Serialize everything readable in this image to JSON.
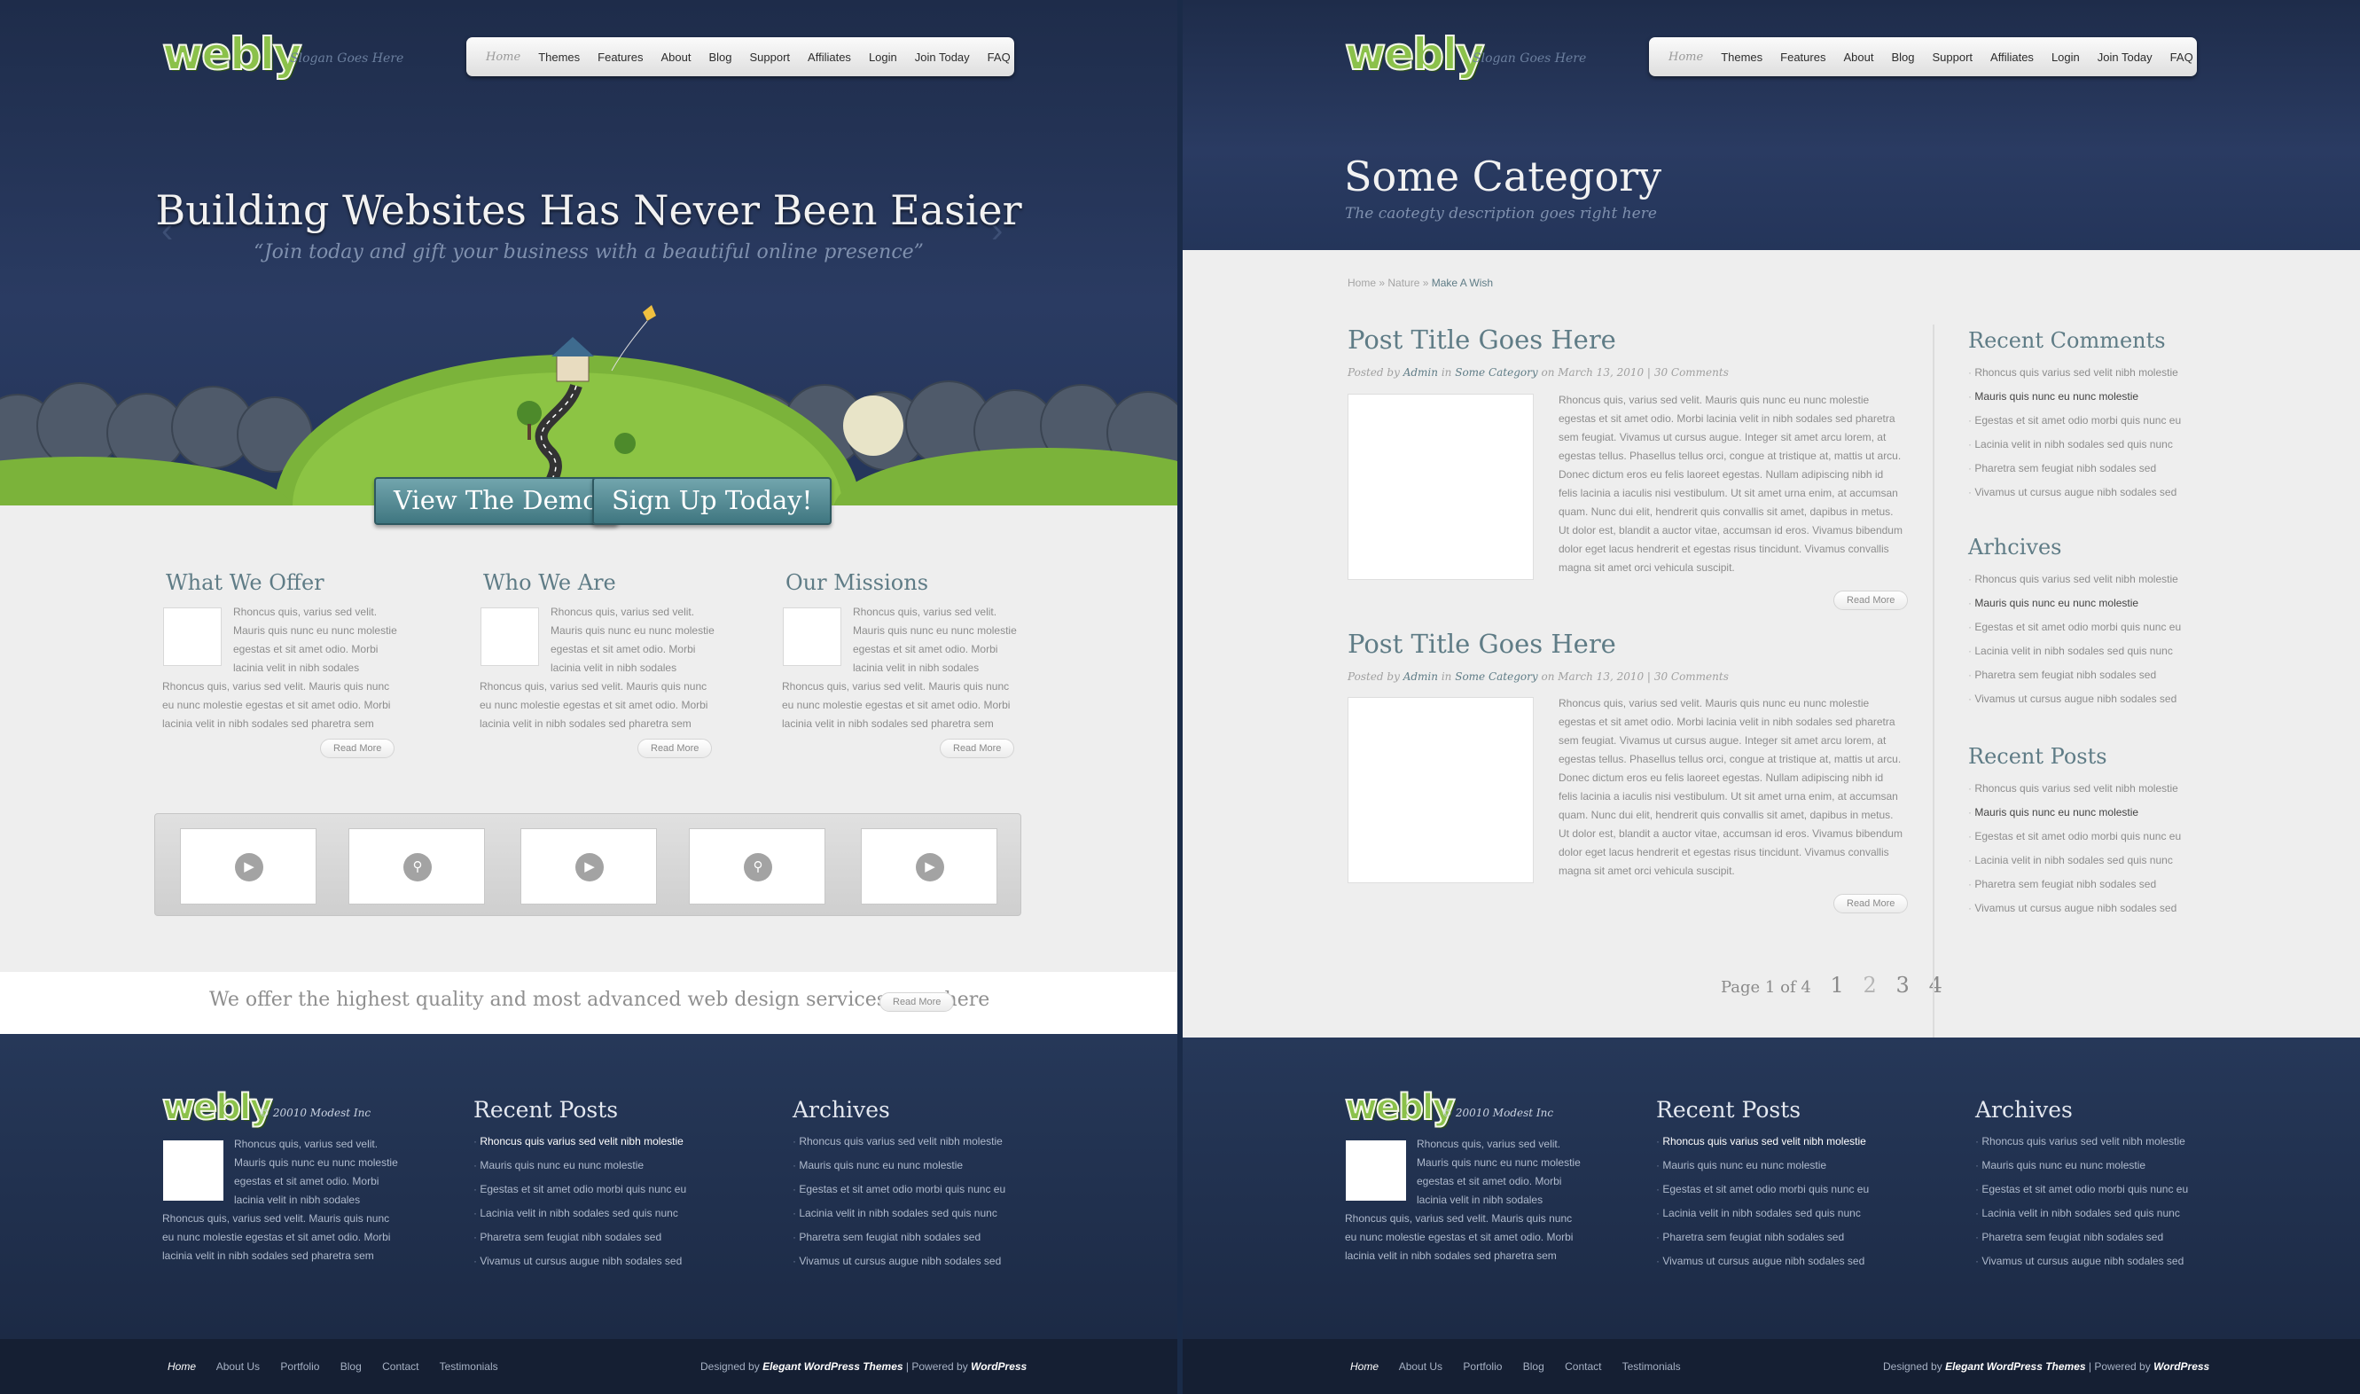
{
  "left": {
    "header": {
      "logo": "webly",
      "slogan": "Slogan Goes Here"
    },
    "nav": [
      "Home",
      "Themes",
      "Features",
      "About",
      "Blog",
      "Support",
      "Affiliates",
      "Login",
      "Join Today",
      "FAQ"
    ],
    "hero": {
      "title": "Building Websites Has Never Been Easier",
      "subtitle": "“Join today and gift your business with a beautiful online presence”",
      "demo_button": "View The Demo",
      "signup_button": "Sign Up Today!"
    },
    "columns": [
      {
        "title": "What We Offer",
        "text_a": "Rhoncus quis, varius sed velit. Mauris quis nunc eu nunc molestie egestas et sit amet odio. Morbi lacinia velit in nibh sodales",
        "text_b": "Rhoncus quis, varius sed velit. Mauris quis nunc eu nunc molestie egestas et sit amet odio. Morbi lacinia velit in nibh sodales sed pharetra sem"
      },
      {
        "title": "Who We Are",
        "text_a": "Rhoncus quis, varius sed velit. Mauris quis nunc eu nunc molestie egestas et sit amet odio. Morbi lacinia velit in nibh sodales",
        "text_b": "Rhoncus quis, varius sed velit. Mauris quis nunc eu nunc molestie egestas et sit amet odio. Morbi lacinia velit in nibh sodales sed pharetra sem"
      },
      {
        "title": "Our Missions",
        "text_a": "Rhoncus quis, varius sed velit. Mauris quis nunc eu nunc molestie egestas et sit amet odio. Morbi lacinia velit in nibh sodales",
        "text_b": "Rhoncus quis, varius sed velit. Mauris quis nunc eu nunc molestie egestas et sit amet odio. Morbi lacinia velit in nibh sodales sed pharetra sem"
      }
    ],
    "read_more": "Read More",
    "gallery_icons": [
      "play",
      "zoom",
      "play",
      "zoom",
      "play"
    ],
    "tagline": "We offer the highest quality and most advanced web design services anywhere"
  },
  "right": {
    "header": {
      "logo": "webly",
      "slogan": "Slogan Goes Here"
    },
    "category_title": "Some Category",
    "category_desc": "The caotegty description goes right here",
    "breadcrumb": {
      "home": "Home",
      "sep": " » ",
      "nature": "Nature",
      "current": "Make A Wish"
    },
    "posts": [
      {
        "title": "Post Title Goes Here",
        "posted_by": "Posted by",
        "author": "Admin",
        "in": "in",
        "category": "Some Category",
        "date": "on March 13, 2010 |",
        "comments": "30 Comments",
        "body": "Rhoncus quis, varius sed velit. Mauris quis nunc eu nunc molestie egestas et sit amet odio. Morbi lacinia velit in nibh sodales sed pharetra sem feugiat. Vivamus ut cursus augue. Integer sit amet arcu lorem, at egestas tellus. Phasellus tellus orci, congue at tristique at, mattis ut arcu. Donec dictum eros eu felis laoreet egestas. Nullam adipiscing nibh id felis lacinia a iaculis nisi vestibulum. Ut sit amet urna enim, at accumsan quam. Nunc dui elit, hendrerit quis convallis sit amet, dapibus in metus. Ut dolor est, blandit a auctor vitae, accumsan id eros. Vivamus bibendum dolor eget lacus hendrerit et egestas risus tincidunt. Vivamus convallis magna sit amet orci vehicula suscipit."
      },
      {
        "title": "Post Title Goes Here",
        "posted_by": "Posted by",
        "author": "Admin",
        "in": "in",
        "category": "Some Category",
        "date": "on March 13, 2010 |",
        "comments": "30 Comments",
        "body": "Rhoncus quis, varius sed velit. Mauris quis nunc eu nunc molestie egestas et sit amet odio. Morbi lacinia velit in nibh sodales sed pharetra sem feugiat. Vivamus ut cursus augue. Integer sit amet arcu lorem, at egestas tellus. Phasellus tellus orci, congue at tristique at, mattis ut arcu. Donec dictum eros eu felis laoreet egestas. Nullam adipiscing nibh id felis lacinia a iaculis nisi vestibulum. Ut sit amet urna enim, at accumsan quam. Nunc dui elit, hendrerit quis convallis sit amet, dapibus in metus. Ut dolor est, blandit a auctor vitae, accumsan id eros. Vivamus bibendum dolor eget lacus hendrerit et egestas risus tincidunt. Vivamus convallis magna sit amet orci vehicula suscipit."
      }
    ],
    "read_more": "Read More",
    "pagination": {
      "label": "Page 1 of 4",
      "pages": [
        "1",
        "2",
        "3",
        "4"
      ]
    },
    "sidebar": {
      "comments_title": "Recent Comments",
      "archives_title": "Arhcives",
      "posts_title": "Recent Posts",
      "items": [
        "Rhoncus quis varius sed velit nibh molestie",
        "Mauris quis nunc eu nunc molestie",
        "Egestas et sit amet odio morbi quis nunc eu",
        "Lacinia velit in nibh sodales sed quis nunc",
        "Pharetra sem feugiat nibh sodales sed",
        "Vivamus ut cursus augue nibh sodales sed"
      ]
    }
  },
  "footer": {
    "logo": "webly",
    "copyright": "© 20010 Modest Inc",
    "about_a": "Rhoncus quis, varius sed velit. Mauris quis nunc eu nunc molestie egestas et sit amet odio. Morbi lacinia velit in nibh sodales",
    "about_b": "Rhoncus quis, varius sed velit. Mauris quis nunc eu nunc molestie egestas et sit amet odio. Morbi lacinia velit in nibh sodales sed pharetra sem",
    "recent_posts_title": "Recent Posts",
    "archives_title": "Archives",
    "items": [
      "Rhoncus quis varius sed velit nibh molestie",
      "Mauris quis nunc eu nunc molestie",
      "Egestas et sit amet odio morbi quis nunc eu",
      "Lacinia velit in nibh sodales sed quis nunc",
      "Pharetra sem feugiat nibh sodales sed",
      "Vivamus ut cursus augue nibh sodales sed"
    ],
    "bottom_nav": [
      "Home",
      "About Us",
      "Portfolio",
      "Blog",
      "Contact",
      "Testimonials"
    ],
    "credit_pre": "Designed by",
    "credit_a": "Elegant WordPress Themes",
    "credit_mid": "| Powered by",
    "credit_b": "WordPress"
  },
  "colors": {
    "accent": "#5f7c86",
    "header_bg": "#24355a",
    "logo_green": "#8bc14a",
    "button_teal": "#4f8790"
  }
}
